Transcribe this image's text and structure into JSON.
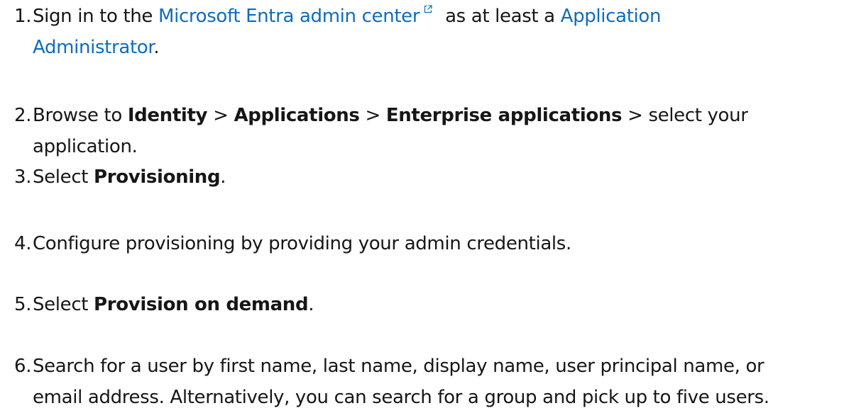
{
  "steps": [
    {
      "number": "1.",
      "prefix": "Sign in to the ",
      "link1": "Microsoft Entra admin center",
      "middle": " as at least a ",
      "link2a": "Application",
      "link2b": "Administrator",
      "suffix": "."
    },
    {
      "number": "2.",
      "t1": "Browse to ",
      "b1": "Identity",
      "t2": " > ",
      "b2": "Applications",
      "t3": " > ",
      "b3": "Enterprise applications",
      "t4": " > select your",
      "line2": "application."
    },
    {
      "number": "3.",
      "t1": "Select ",
      "b1": "Provisioning",
      "t2": "."
    },
    {
      "number": "4.",
      "text": "Configure provisioning by providing your admin credentials."
    },
    {
      "number": "5.",
      "t1": "Select ",
      "b1": "Provision on demand",
      "t2": "."
    },
    {
      "number": "6.",
      "line1": "Search for a user by first name, last name, display name, user principal name, or",
      "line2": "email address. Alternatively, you can search for a group and pick up to five users."
    }
  ],
  "icons": {
    "external_link": "external-link-icon"
  },
  "colors": {
    "link": "#0f6cbd",
    "text": "#161616"
  }
}
